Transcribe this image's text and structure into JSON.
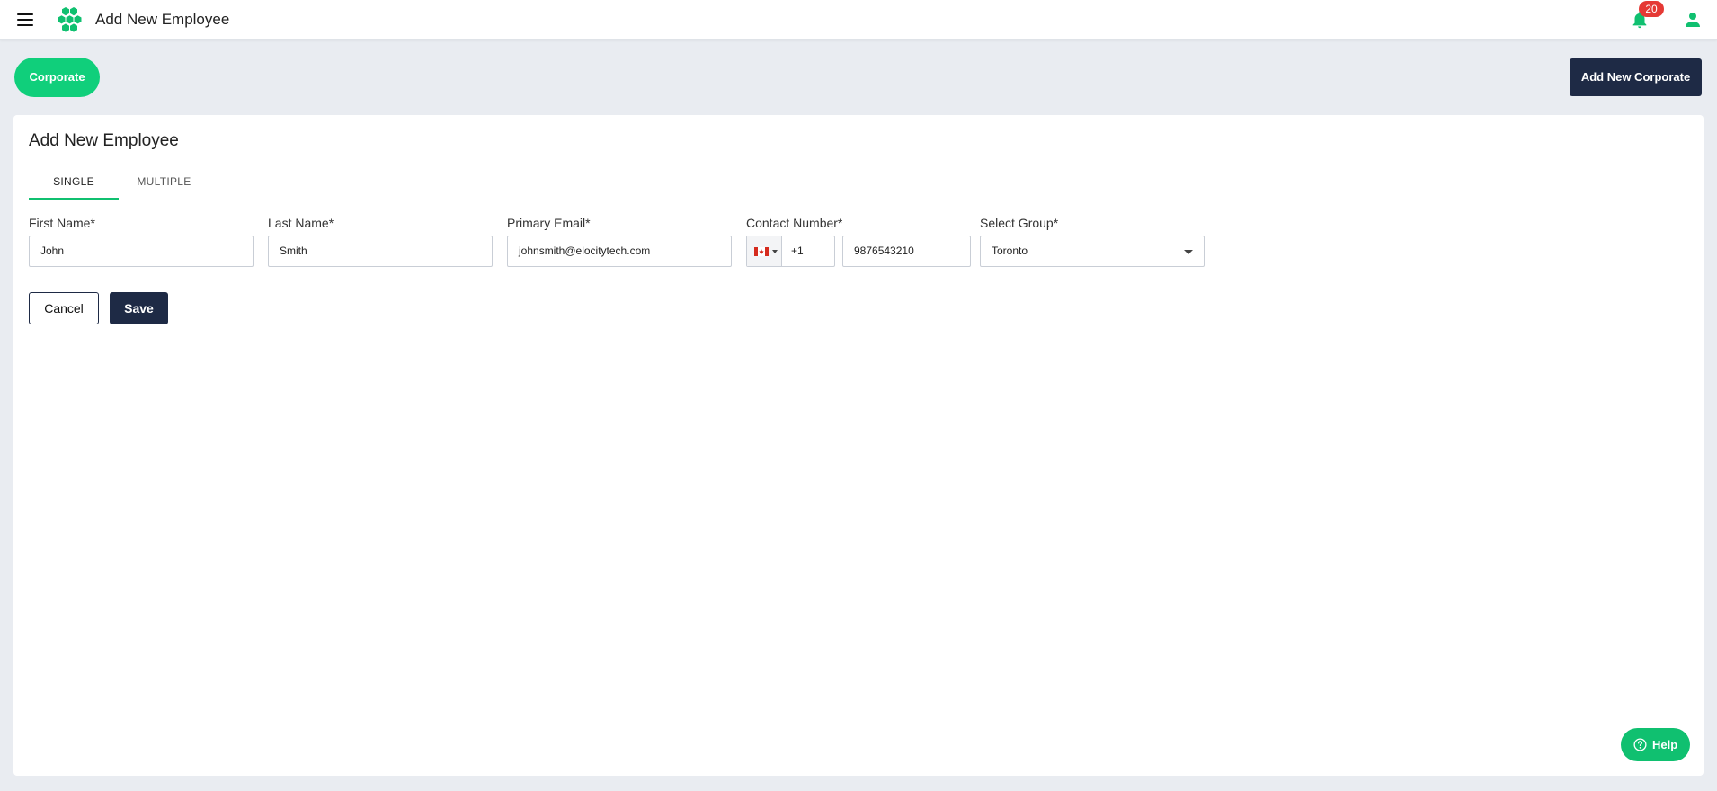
{
  "app": {
    "page_title": "Add New Employee",
    "notification_count": "20"
  },
  "toolbar": {
    "corporate_label": "Corporate",
    "add_corporate_label": "Add New Corporate"
  },
  "form": {
    "title": "Add New Employee",
    "tabs": [
      {
        "label": "SINGLE",
        "active": true
      },
      {
        "label": "MULTIPLE",
        "active": false
      }
    ],
    "fields": {
      "first_name": {
        "label": "First Name*",
        "value": "John"
      },
      "last_name": {
        "label": "Last Name*",
        "value": "Smith"
      },
      "email": {
        "label": "Primary Email*",
        "value": "johnsmith@elocitytech.com"
      },
      "contact": {
        "label": "Contact Number*",
        "country": "Canada",
        "dial_code": "+1",
        "value": "9876543210"
      },
      "group": {
        "label": "Select Group*",
        "value": "Toronto"
      }
    },
    "cancel_label": "Cancel",
    "save_label": "Save"
  },
  "help": {
    "label": "Help"
  },
  "colors": {
    "accent_green": "#10cf7b",
    "navy": "#1e2a45",
    "badge_red": "#e53935",
    "page_background": "#e9ecf1"
  },
  "icons": [
    "menu-icon",
    "logo-icon",
    "bell-icon",
    "user-icon",
    "canada-flag-icon",
    "chevron-down-icon",
    "help-circle-icon"
  ]
}
